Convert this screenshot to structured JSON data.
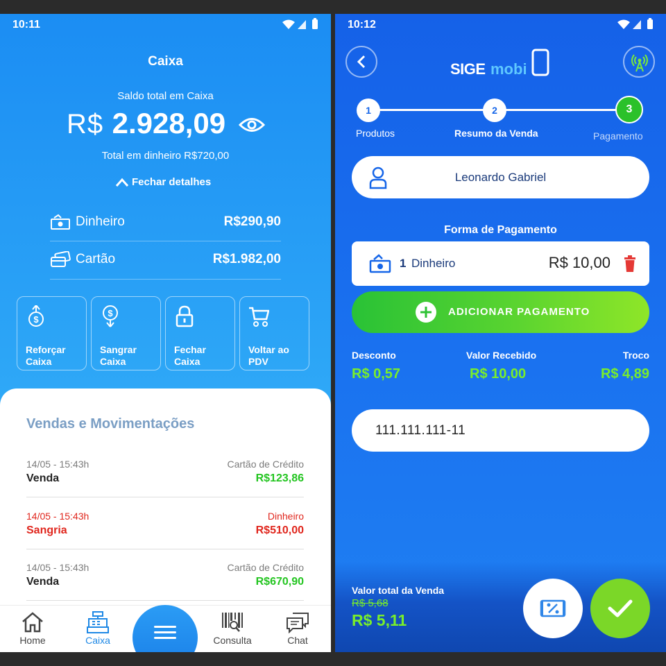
{
  "left": {
    "status_time": "10:11",
    "title": "Caixa",
    "saldo_label": "Saldo total em Caixa",
    "currency": "R$",
    "amount": "2.928,09",
    "cash_total": "Total em dinheiro R$720,00",
    "toggle_details": "Fechar detalhes",
    "breakdown": [
      {
        "label": "Dinheiro",
        "value": "R$290,90"
      },
      {
        "label": "Cartão",
        "value": "R$1.982,00"
      }
    ],
    "actions": [
      {
        "line1": "Reforçar",
        "line2": "Caixa"
      },
      {
        "line1": "Sangrar",
        "line2": "Caixa"
      },
      {
        "line1": "Fechar",
        "line2": "Caixa"
      },
      {
        "line1": "Voltar ao",
        "line2": "PDV"
      }
    ],
    "movements_title": "Vendas e Movimentações",
    "movements": [
      {
        "date": "14/05 - 15:43h",
        "type": "Venda",
        "method": "Cartão de Crédito",
        "value": "R$123,86"
      },
      {
        "date": "14/05 - 15:43h",
        "type": "Sangria",
        "method": "Dinheiro",
        "value": "R$510,00"
      },
      {
        "date": "14/05 - 15:43h",
        "type": "Venda",
        "method": "Cartão de Crédito",
        "value": "R$670,90"
      }
    ],
    "nav": [
      {
        "label": "Home"
      },
      {
        "label": "Caixa"
      },
      {
        "label": "Consulta"
      },
      {
        "label": "Chat"
      }
    ]
  },
  "right": {
    "status_time": "10:12",
    "logo_sige": "SIGE",
    "logo_mobi": "mobi",
    "steps": [
      {
        "num": "1",
        "label": "Produtos"
      },
      {
        "num": "2",
        "label": "Resumo da Venda"
      },
      {
        "num": "3",
        "label": "Pagamento"
      }
    ],
    "customer_name": "Leonardo Gabriel",
    "payment_form_title": "Forma de Pagamento",
    "payment": {
      "qty": "1",
      "method": "Dinheiro",
      "amount": "R$ 10,00"
    },
    "add_payment_label": "ADICIONAR PAGAMENTO",
    "summary": [
      {
        "label": "Desconto",
        "value": "R$ 0,57"
      },
      {
        "label": "Valor Recebido",
        "value": "R$ 10,00"
      },
      {
        "label": "Troco",
        "value": "R$ 4,89"
      }
    ],
    "cpf_value": "111.111.111-11",
    "total_label": "Valor total da Venda",
    "total_old": "R$ 5,68",
    "total_new": "R$ 5,11"
  },
  "colors": {
    "left_bg": "#1b8df3",
    "right_bg": "#1561e8",
    "green_value": "#24c521",
    "red_value": "#e0261d",
    "lime": "#79ee2a",
    "step_active": "#2bc12a"
  }
}
